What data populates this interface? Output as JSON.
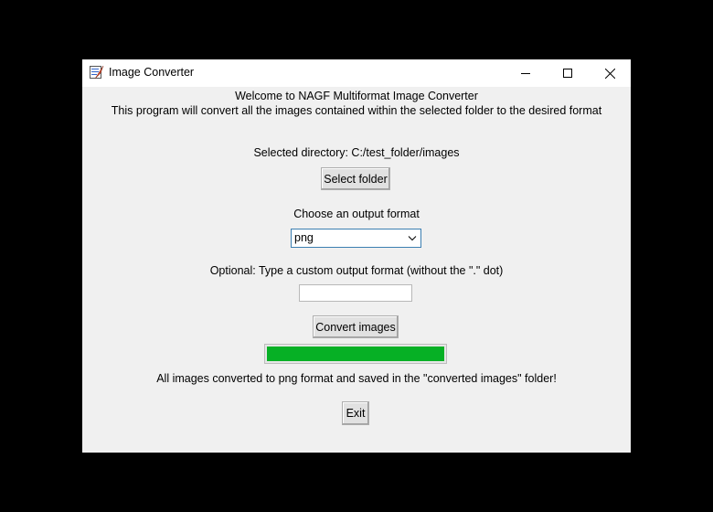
{
  "window": {
    "title": "Image Converter"
  },
  "header": {
    "welcome": "Welcome to NAGF Multiformat Image Converter",
    "description": "This program will convert all the images contained within the selected folder to the desired format"
  },
  "directory": {
    "label": "Selected directory: C:/test_folder/images",
    "select_button": "Select folder"
  },
  "format": {
    "label": "Choose an output format",
    "selected": "png"
  },
  "custom_format": {
    "label": "Optional: Type a custom output format (without the \".\" dot)",
    "value": ""
  },
  "convert": {
    "button": "Convert images",
    "progress_percent": 100,
    "progress_color": "#06b025",
    "status": "All images converted to png format and saved in the \"converted images\" folder!"
  },
  "exit_button": "Exit"
}
